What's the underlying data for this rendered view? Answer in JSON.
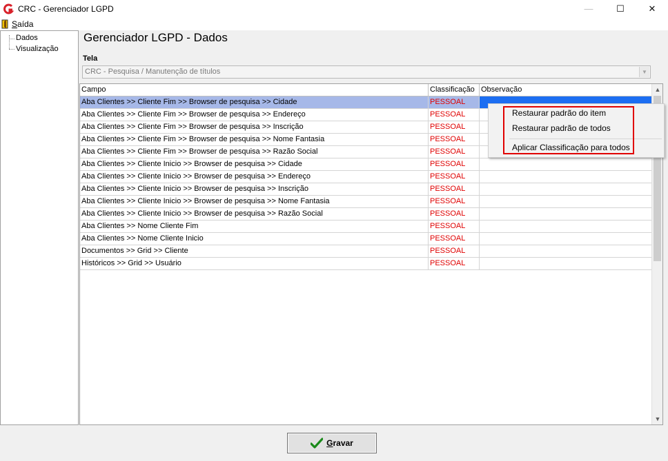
{
  "window": {
    "title": "CRC - Gerenciador LGPD"
  },
  "menu": {
    "exit_label": "Saída"
  },
  "tree": {
    "items": [
      "Dados",
      "Visualização"
    ]
  },
  "page": {
    "heading": "Gerenciador LGPD - Dados"
  },
  "tela": {
    "label": "Tela",
    "value": "CRC - Pesquisa / Manutenção de títulos"
  },
  "grid": {
    "columns": [
      "Campo",
      "Classificação",
      "Observação"
    ],
    "rows": [
      {
        "campo": "Aba Clientes >> Cliente Fim >> Browser de pesquisa >> Cidade",
        "classificacao": "PESSOAL",
        "observacao": "",
        "selected": true
      },
      {
        "campo": "Aba Clientes >> Cliente Fim >> Browser de pesquisa >> Endereço",
        "classificacao": "PESSOAL",
        "observacao": ""
      },
      {
        "campo": "Aba Clientes >> Cliente Fim >> Browser de pesquisa >> Inscrição",
        "classificacao": "PESSOAL",
        "observacao": ""
      },
      {
        "campo": "Aba Clientes >> Cliente Fim >> Browser de pesquisa >> Nome Fantasia",
        "classificacao": "PESSOAL",
        "observacao": ""
      },
      {
        "campo": "Aba Clientes >> Cliente Fim >> Browser de pesquisa >> Razão Social",
        "classificacao": "PESSOAL",
        "observacao": ""
      },
      {
        "campo": "Aba Clientes >> Cliente Inicio >> Browser de pesquisa >> Cidade",
        "classificacao": "PESSOAL",
        "observacao": ""
      },
      {
        "campo": "Aba Clientes >> Cliente Inicio >> Browser de pesquisa >> Endereço",
        "classificacao": "PESSOAL",
        "observacao": ""
      },
      {
        "campo": "Aba Clientes >> Cliente Inicio >> Browser de pesquisa >> Inscrição",
        "classificacao": "PESSOAL",
        "observacao": ""
      },
      {
        "campo": "Aba Clientes >> Cliente Inicio >> Browser de pesquisa >> Nome Fantasia",
        "classificacao": "PESSOAL",
        "observacao": ""
      },
      {
        "campo": "Aba Clientes >> Cliente Inicio >> Browser de pesquisa >> Razão Social",
        "classificacao": "PESSOAL",
        "observacao": ""
      },
      {
        "campo": "Aba Clientes >> Nome Cliente Fim",
        "classificacao": "PESSOAL",
        "observacao": ""
      },
      {
        "campo": "Aba Clientes >> Nome Cliente Inicio",
        "classificacao": "PESSOAL",
        "observacao": ""
      },
      {
        "campo": "Documentos >> Grid >> Cliente",
        "classificacao": "PESSOAL",
        "observacao": ""
      },
      {
        "campo": "Históricos >> Grid >> Usuário",
        "classificacao": "PESSOAL",
        "observacao": ""
      }
    ]
  },
  "context_menu": {
    "items": [
      "Restaurar padrão do item",
      "Restaurar padrão de todos",
      "Aplicar Classificação para todos"
    ]
  },
  "buttons": {
    "save_label": "Gravar"
  },
  "colors": {
    "classification_text": "#e00000",
    "selected_row": "#a6b8e8",
    "selected_cell": "#1c6ef2",
    "highlight_box": "#e00000",
    "brand_icon": "#d8212a",
    "save_check": "#1a8a1a"
  },
  "icons": {
    "app": "crc-logo-icon",
    "exit": "exit-door-icon",
    "save": "checkmark-icon",
    "combo": "chevron-down-icon"
  }
}
